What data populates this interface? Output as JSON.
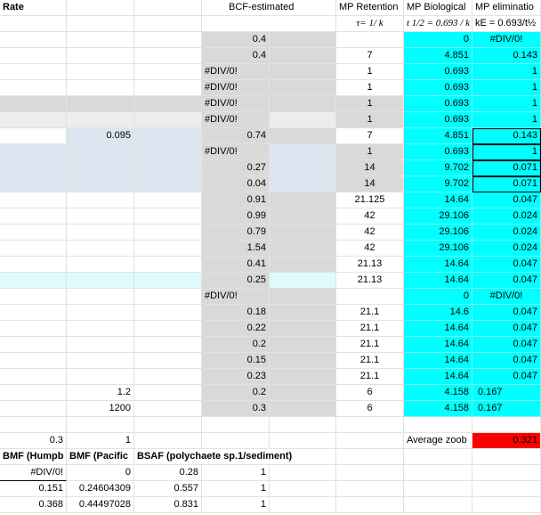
{
  "header": {
    "a": "Rate",
    "d": "BCF-estimated",
    "e": "MP Retention",
    "f": "MP Biological",
    "g": "MP eliminatio"
  },
  "subheader": {
    "e": "τ= 1/ k",
    "f": "t 1/2 = 0.693 / k",
    "g": "kE = 0.693/t½"
  },
  "rows": [
    {
      "d": "0.4",
      "e": "",
      "f": "0",
      "g": "#DIV/0!"
    },
    {
      "d": "0.4",
      "e": "7",
      "f": "4.851",
      "g": "0.143"
    },
    {
      "d": "#DIV/0!",
      "e": "1",
      "f": "0.693",
      "g": "1"
    },
    {
      "d": "#DIV/0!",
      "e": "1",
      "f": "0.693",
      "g": "1"
    },
    {
      "d": "#DIV/0!",
      "e": "1",
      "f": "0.693",
      "g": "1"
    },
    {
      "d": "#DIV/0!",
      "e": "1",
      "f": "0.693",
      "g": "1"
    },
    {
      "b": "0.095",
      "d": "0.74",
      "e": "7",
      "f": "4.851",
      "g": "0.143"
    },
    {
      "d": "#DIV/0!",
      "e": "1",
      "f": "0.693",
      "g": "1"
    },
    {
      "d": "0.27",
      "e": "14",
      "f": "9.702",
      "g": "0.071"
    },
    {
      "d": "0.04",
      "e": "14",
      "f": "9.702",
      "g": "0.071"
    },
    {
      "d": "0.91",
      "e": "21.125",
      "f": "14.64",
      "g": "0.047"
    },
    {
      "d": "0.99",
      "e": "42",
      "f": "29.106",
      "g": "0.024"
    },
    {
      "d": "0.79",
      "e": "42",
      "f": "29.106",
      "g": "0.024"
    },
    {
      "d": "1.54",
      "e": "42",
      "f": "29.106",
      "g": "0.024"
    },
    {
      "d": "0.41",
      "e": "21.13",
      "f": "14.64",
      "g": "0.047"
    },
    {
      "d": "0.25",
      "e": "21.13",
      "f": "14.64",
      "g": "0.047"
    },
    {
      "d": "#DIV/0!",
      "e": "",
      "f": "0",
      "g": "#DIV/0!"
    },
    {
      "d": "0.18",
      "e": "21.1",
      "f": "14.6",
      "g": "0.047"
    },
    {
      "d": "0.22",
      "e": "21.1",
      "f": "14.64",
      "g": "0.047"
    },
    {
      "d": "0.2",
      "e": "21.1",
      "f": "14.64",
      "g": "0.047"
    },
    {
      "d": "0.15",
      "e": "21.1",
      "f": "14.64",
      "g": "0.047"
    },
    {
      "d": "0.23",
      "e": "21.1",
      "f": "14.64",
      "g": "0.047"
    },
    {
      "b": "1.2",
      "d": "0.2",
      "e": "6",
      "f": "4.158",
      "g": "0.167"
    },
    {
      "b": "1200",
      "d": "0.3",
      "e": "6",
      "f": "4.158",
      "g": "0.167"
    },
    {},
    {
      "a": "0.3",
      "b": "1",
      "f": "Average zoob",
      "g": "0.321"
    }
  ],
  "bottom_header": {
    "a": "BMF (Humpb",
    "b": "BMF (Pacific",
    "c": "BSAF (polychaete sp.1/sediment)"
  },
  "bottom_rows": [
    {
      "a": "#DIV/0!",
      "b": "0",
      "c": "0.28",
      "d": "1"
    },
    {
      "a": "0.151",
      "b": "0.24604309",
      "c": "0.557",
      "d": "1"
    },
    {
      "a": "0.368",
      "b": "0.44497028",
      "c": "0.831",
      "d": "1"
    }
  ],
  "colors": {
    "highlight_cyan": "#00ffff",
    "gray": "#d9d9d9",
    "blue": "#dce6f1",
    "alert_red": "#ff0000"
  }
}
